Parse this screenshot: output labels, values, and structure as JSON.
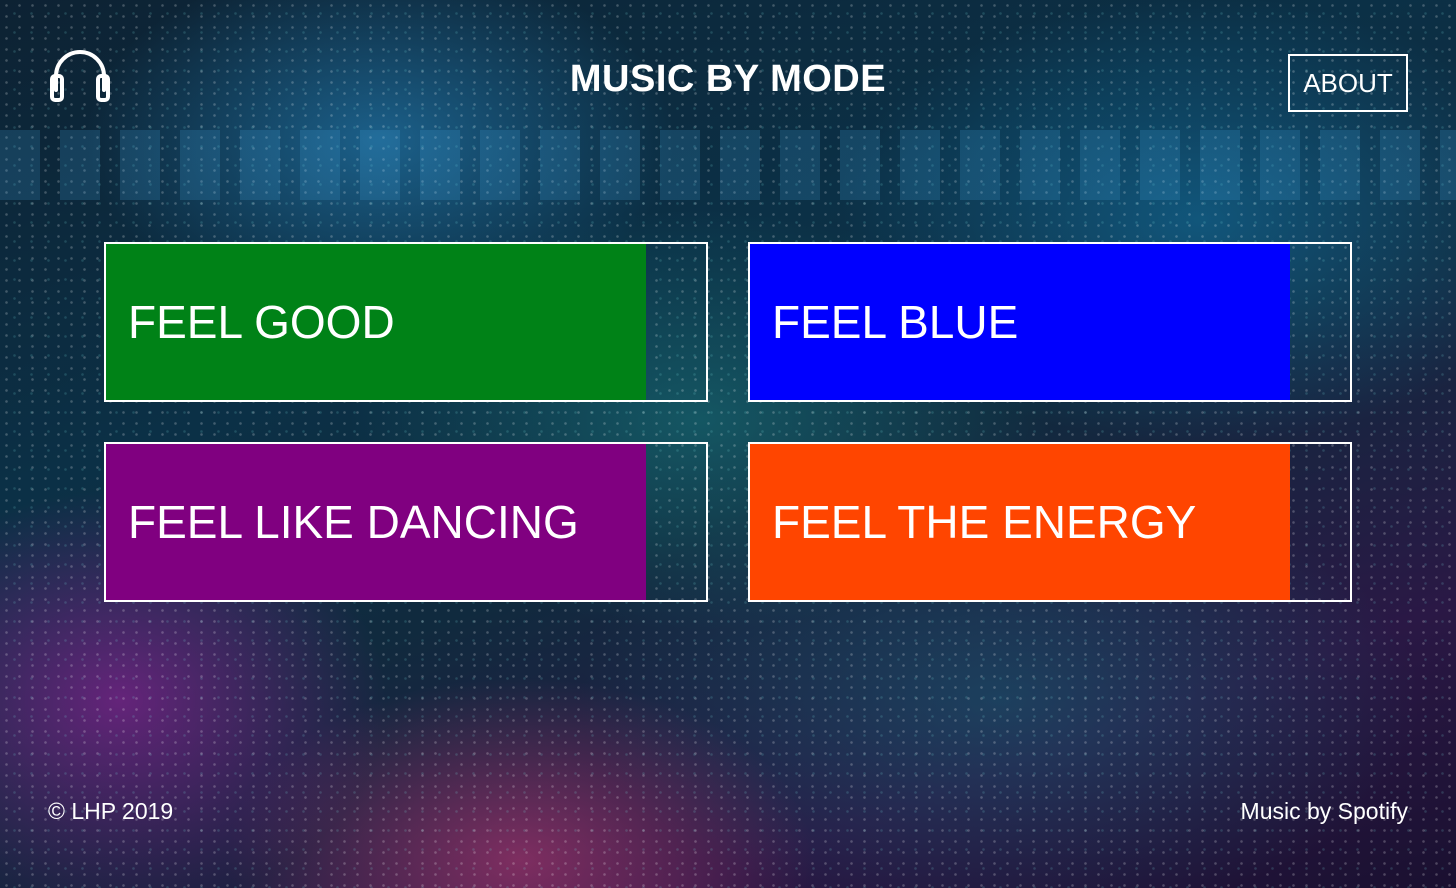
{
  "header": {
    "title": "MUSIC BY MODE",
    "logo_icon": "headphones-icon",
    "about_label": "ABOUT"
  },
  "modes": [
    {
      "label": "FEEL GOOD",
      "color": "#008217",
      "fill_fraction": 0.9
    },
    {
      "label": "FEEL BLUE",
      "color": "#0000ff",
      "fill_fraction": 0.9
    },
    {
      "label": "FEEL LIKE DANCING",
      "color": "#800080",
      "fill_fraction": 0.9
    },
    {
      "label": "FEEL THE ENERGY",
      "color": "#ff4500",
      "fill_fraction": 0.9
    }
  ],
  "footer": {
    "copyright": "© LHP 2019",
    "credit": "Music by Spotify"
  }
}
